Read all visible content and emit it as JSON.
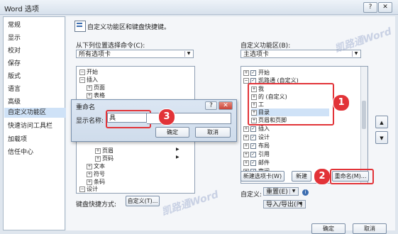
{
  "window": {
    "title": "Word 选项",
    "help_button": "?",
    "close_button": "✕"
  },
  "sidebar": {
    "items": [
      {
        "label": "常规",
        "selected": false
      },
      {
        "label": "显示",
        "selected": false
      },
      {
        "label": "校对",
        "selected": false
      },
      {
        "label": "保存",
        "selected": false
      },
      {
        "label": "版式",
        "selected": false
      },
      {
        "label": "语言",
        "selected": false
      },
      {
        "label": "高级",
        "selected": false
      },
      {
        "label": "自定义功能区",
        "selected": true
      },
      {
        "label": "快速访问工具栏",
        "selected": false
      },
      {
        "label": "加载项",
        "selected": false
      },
      {
        "label": "信任中心",
        "selected": false
      }
    ]
  },
  "main": {
    "header": "自定义功能区和键盘快捷键。",
    "left_label": "从下列位置选择命令(C):",
    "left_combo": "所有选项卡",
    "right_label": "自定义功能区(B):",
    "right_combo": "主选项卡",
    "left_tree_top": [
      "开始",
      "插入",
      "页面",
      "表格"
    ],
    "left_tree_bottom": [
      "页眉",
      "页码",
      "文本",
      "符号",
      "条码",
      "设计"
    ],
    "right_tree_top": [
      "开始",
      "凯路通 (自定义)"
    ],
    "group_items": [
      "我",
      "的 (自定义)",
      "工",
      "目录",
      "页眉和页脚"
    ],
    "right_tree_bottom": [
      "插入",
      "设计",
      "布局",
      "引用",
      "邮件",
      "审阅"
    ],
    "new_tab_button": "新建选项卡(W)",
    "new_group_button": "新建",
    "rename_button": "重命名(M)...",
    "custom_label": "自定义:",
    "reset_combo": "重置(E)",
    "import_combo": "导入/导出(P)",
    "shortcut_label": "键盘快捷方式:",
    "shortcut_button": "自定义(T)...",
    "ok_button": "确定",
    "cancel_button": "取消",
    "up_arrow": "▲",
    "down_arrow": "▼"
  },
  "rename_dialog": {
    "title": "重命名",
    "help": "?",
    "close": "✕",
    "label": "显示名称:",
    "value": "具",
    "ok": "确定",
    "cancel": "取消"
  },
  "annotations": [
    "1",
    "2",
    "3"
  ],
  "watermark": "凯路通Word",
  "colors": {
    "annotation": "#e23338",
    "selected": "#cfe2f7"
  }
}
